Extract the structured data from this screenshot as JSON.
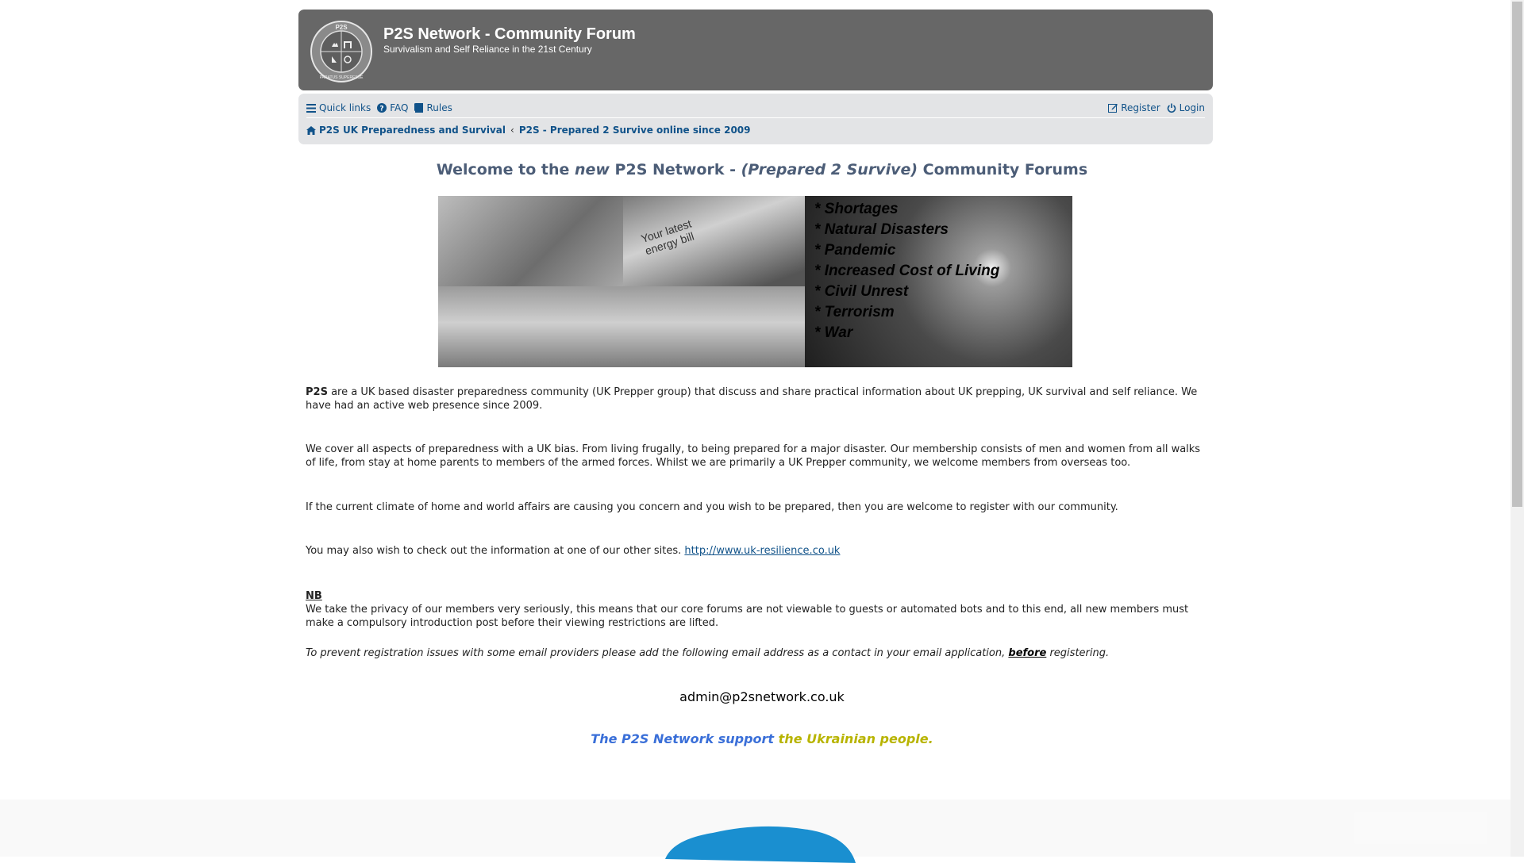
{
  "header": {
    "site_title": "P2S Network - Community Forum",
    "site_desc": "Survivalism and Self Reliance in the 21st Century",
    "logo_text_top": "P2S",
    "logo_text_bottom": "PARATUS SUPERESSE"
  },
  "nav": {
    "quick_links": "Quick links",
    "faq": "FAQ",
    "rules": "Rules",
    "register": "Register",
    "login": "Login"
  },
  "breadcrumb": {
    "home": "P2S UK Preparedness and Survival",
    "current": "P2S - Prepared 2 Survive online since 2009"
  },
  "welcome": {
    "part1": "Welcome to the ",
    "part2": "new",
    "part3": " P2S Network - ",
    "part4": "(Prepared 2 Survive)",
    "part5": " Community Forums"
  },
  "banner": {
    "bill_text_line1": "Your latest",
    "bill_text_line2": "energy bill",
    "items": [
      "* Shortages",
      "* Natural Disasters",
      "* Pandemic",
      "* Increased Cost of Living",
      "* Civil Unrest",
      "* Terrorism",
      "* War"
    ]
  },
  "content": {
    "p1_bold": "P2S",
    "p1_rest": " are a UK based disaster preparedness community (UK Prepper group) that discuss and share practical information about UK prepping, UK survival and self reliance. We have had an active web presence since 2009.",
    "p2": "We cover all aspects of preparedness with a UK bias. From living frugally, to being prepared for a major disaster. Our membership consists of men and women from all walks of life, from stay at home parents to members of the armed forces. Whilst we are primarily a UK Prepper community, we welcome members from overseas too.",
    "p3": "If the current climate of home and world affairs are causing you concern and you wish to be prepared, then you are welcome to register with our community.",
    "p4_text": "You may also wish to check out the information at one of our other sites. ",
    "p4_link": "http://www.uk-resilience.co.uk",
    "nb_label": "NB",
    "p5": "We take the privacy of our members very seriously, this means that our core forums are not viewable to guests or automated bots and to this end, all new members must make a compulsory introduction post before their viewing restrictions are lifted.",
    "p6_a": "To prevent registration issues with some email providers please add the following email address as a contact in your email application, ",
    "p6_b": "before",
    "p6_c": " registering.",
    "email": "admin@p2snetwork.co.uk",
    "ukraine_a": "The P2S Network support ",
    "ukraine_b": "the Ukrainian people."
  },
  "colors": {
    "header_bg": "#676767",
    "nav_bg": "#e3e4e6",
    "link": "#105289",
    "welcome": "#4c5d77",
    "ukraine_blue": "#3a6fd8",
    "ukraine_yellow": "#b8b400",
    "flag_blue": "#1a8fd0"
  }
}
